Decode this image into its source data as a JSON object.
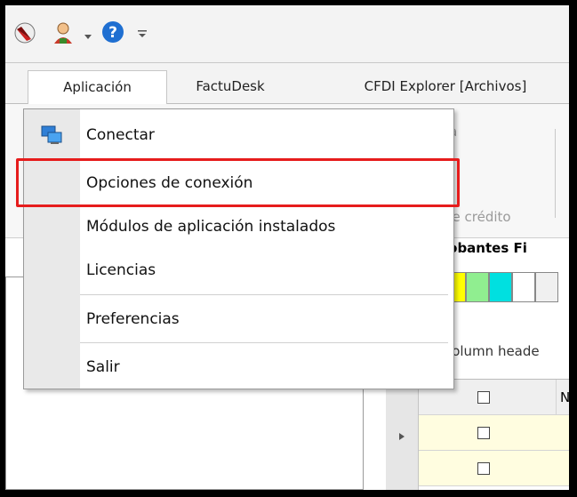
{
  "quick_access": {
    "icons": [
      "app-logo-icon",
      "user-icon",
      "dropdown-arrow-icon",
      "help-icon",
      "customize-icon"
    ]
  },
  "tabs": [
    {
      "label": "Aplicación",
      "active": true
    },
    {
      "label": "FactuDesk",
      "active": false
    },
    {
      "label": "CFDI Explorer [Archivos]",
      "active": false
    }
  ],
  "ribbon": {
    "fragment_top": "ra",
    "fragment_bottom": "de crédito"
  },
  "grid": {
    "title": "probantes Fi",
    "group_hint": "a column heade",
    "column_header": "N",
    "swatch_colors": [
      "#ffff00",
      "#90ee90",
      "#00e0e0",
      "#ffffff",
      "#f0f0f0"
    ]
  },
  "menu": {
    "items": [
      {
        "label": "Conectar",
        "icon": "connect-icon"
      },
      {
        "label": "Opciones de conexión",
        "icon": ""
      },
      {
        "label": "Módulos de aplicación instalados",
        "icon": ""
      },
      {
        "label": "Licencias",
        "icon": ""
      },
      {
        "label": "Preferencias",
        "icon": ""
      },
      {
        "label": "Salir",
        "icon": ""
      }
    ]
  },
  "colors": {
    "highlight": "#e61c1c",
    "row_selected": "#fffde0"
  }
}
